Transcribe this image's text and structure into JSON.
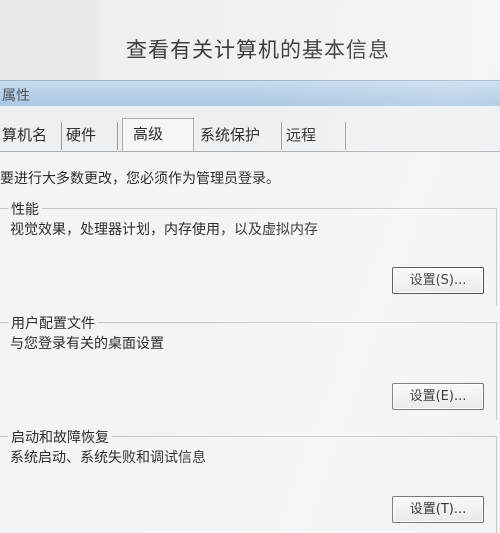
{
  "banner": {
    "title": "查看有关计算机的基本信息"
  },
  "dialog": {
    "title": "属性"
  },
  "tabs": [
    {
      "label": "算机名"
    },
    {
      "label": "硬件"
    },
    {
      "label": "高级"
    },
    {
      "label": "系统保护"
    },
    {
      "label": "远程"
    }
  ],
  "active_tab": "高级",
  "notice": "要进行大多数更改，您必须作为管理员登录。",
  "groups": {
    "performance": {
      "title": "性能",
      "description": "视觉效果，处理器计划，内存使用，以及虚拟内存",
      "button": "设置(S)..."
    },
    "user_profiles": {
      "title": "用户配置文件",
      "description": "与您登录有关的桌面设置",
      "button": "设置(E)..."
    },
    "startup_recovery": {
      "title": "启动和故障恢复",
      "description": "系统启动、系统失败和调试信息",
      "button": "设置(T)..."
    }
  }
}
